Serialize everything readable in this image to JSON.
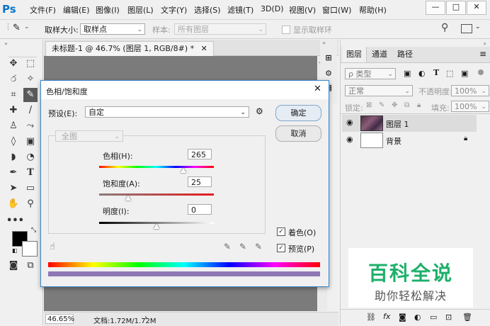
{
  "app": {
    "logo": "Ps"
  },
  "menu": [
    "文件(F)",
    "编辑(E)",
    "图像(I)",
    "图层(L)",
    "文字(Y)",
    "选择(S)",
    "滤镜(T)",
    "3D(D)",
    "视图(V)",
    "窗口(W)",
    "帮助(H)"
  ],
  "window_controls": {
    "minimize": "—",
    "maximize": "□",
    "close": "✕"
  },
  "options_bar": {
    "sample_size_label": "取样大小:",
    "sample_size_value": "取样点",
    "sample_label": "样本:",
    "sample_value": "所有图层",
    "show_ring_label": "显示取样环"
  },
  "document": {
    "tab_title": "未标题-1 @ 46.7% (图层 1, RGB/8#) *",
    "zoom": "46.65%",
    "doc_info": "文档:1.72M/1.72M"
  },
  "dialog": {
    "title": "色相/饱和度",
    "preset_label": "预设(E):",
    "preset_value": "自定",
    "channel_value": "全图",
    "hue_label": "色相(H):",
    "hue_value": "265",
    "saturation_label": "饱和度(A):",
    "saturation_value": "25",
    "lightness_label": "明度(I):",
    "lightness_value": "0",
    "ok_label": "确定",
    "cancel_label": "取消",
    "colorize_label": "着色(O)",
    "colorize_checked": true,
    "preview_label": "预览(P)",
    "preview_checked": true
  },
  "panels": {
    "tabs": [
      "图层",
      "通道",
      "路径"
    ],
    "kind_filter": "ρ 类型",
    "blend_mode": "正常",
    "opacity_label": "不透明度:",
    "opacity_value": "100%",
    "lock_label": "锁定:",
    "fill_label": "填充:",
    "fill_value": "100%",
    "layers": [
      {
        "name": "图层 1"
      },
      {
        "name": "背景"
      }
    ]
  },
  "watermark": {
    "title": "百科全说",
    "subtitle": "助你轻松解决",
    "title_color": "#1db06a"
  }
}
